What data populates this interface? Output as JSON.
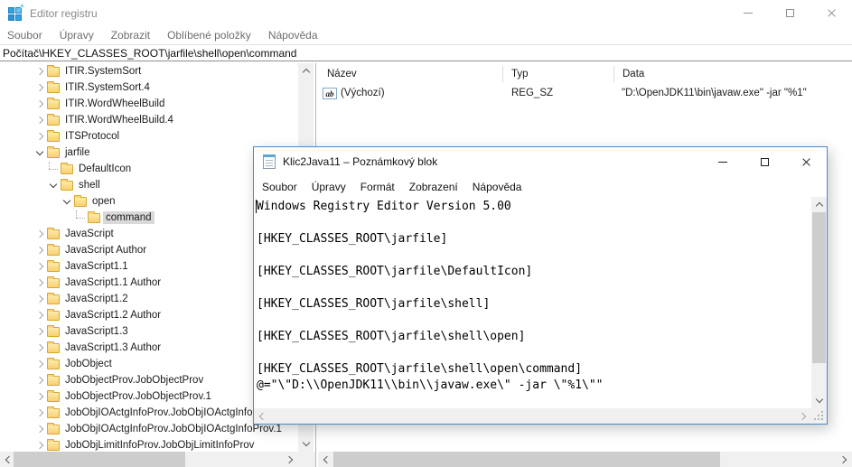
{
  "colors": {
    "accent-blue": "#4a8ac9",
    "selection-gray": "#d9d9d9",
    "scroll-track": "#f0f0f0",
    "scroll-thumb": "#cdcdcd",
    "reg-sz-red": "#c00000"
  },
  "regedit": {
    "title": "Editor registru",
    "menu": [
      "Soubor",
      "Úpravy",
      "Zobrazit",
      "Oblíbené položky",
      "Nápověda"
    ],
    "address": "Počítač\\HKEY_CLASSES_ROOT\\jarfile\\shell\\open\\command",
    "tree": [
      {
        "label": "ITIR.SystemSort",
        "level": 0,
        "state": "collapsed"
      },
      {
        "label": "ITIR.SystemSort.4",
        "level": 0,
        "state": "collapsed"
      },
      {
        "label": "ITIR.WordWheelBuild",
        "level": 0,
        "state": "collapsed"
      },
      {
        "label": "ITIR.WordWheelBuild.4",
        "level": 0,
        "state": "collapsed"
      },
      {
        "label": "ITSProtocol",
        "level": 0,
        "state": "collapsed"
      },
      {
        "label": "jarfile",
        "level": 0,
        "state": "expanded"
      },
      {
        "label": "DefaultIcon",
        "level": 1,
        "state": "leaf"
      },
      {
        "label": "shell",
        "level": 1,
        "state": "expanded"
      },
      {
        "label": "open",
        "level": 2,
        "state": "expanded"
      },
      {
        "label": "command",
        "level": 3,
        "state": "leaf",
        "selected": true
      },
      {
        "label": "JavaScript",
        "level": 0,
        "state": "collapsed"
      },
      {
        "label": "JavaScript Author",
        "level": 0,
        "state": "collapsed"
      },
      {
        "label": "JavaScript1.1",
        "level": 0,
        "state": "collapsed"
      },
      {
        "label": "JavaScript1.1 Author",
        "level": 0,
        "state": "collapsed"
      },
      {
        "label": "JavaScript1.2",
        "level": 0,
        "state": "collapsed"
      },
      {
        "label": "JavaScript1.2 Author",
        "level": 0,
        "state": "collapsed"
      },
      {
        "label": "JavaScript1.3",
        "level": 0,
        "state": "collapsed"
      },
      {
        "label": "JavaScript1.3 Author",
        "level": 0,
        "state": "collapsed"
      },
      {
        "label": "JobObject",
        "level": 0,
        "state": "collapsed"
      },
      {
        "label": "JobObjectProv.JobObjectProv",
        "level": 0,
        "state": "collapsed"
      },
      {
        "label": "JobObjectProv.JobObjectProv.1",
        "level": 0,
        "state": "collapsed"
      },
      {
        "label": "JobObjIOActgInfoProv.JobObjIOActgInfoProv",
        "level": 0,
        "state": "collapsed"
      },
      {
        "label": "JobObjIOActgInfoProv.JobObjIOActgInfoProv.1",
        "level": 0,
        "state": "collapsed"
      },
      {
        "label": "JobObjLimitInfoProv.JobObjLimitInfoProv",
        "level": 0,
        "state": "collapsed"
      }
    ],
    "list": {
      "columns": [
        "Název",
        "Typ",
        "Data"
      ],
      "value_icon": "ab",
      "rows": [
        {
          "name": "(Výchozí)",
          "type": "REG_SZ",
          "data": "\"D:\\OpenJDK11\\bin\\javaw.exe\" -jar \"%1\""
        }
      ]
    }
  },
  "notepad": {
    "title": "Klic2Java11 – Poznámkový blok",
    "menu": [
      "Soubor",
      "Úpravy",
      "Formát",
      "Zobrazení",
      "Nápověda"
    ],
    "content": "Windows Registry Editor Version 5.00\n\n[HKEY_CLASSES_ROOT\\jarfile]\n\n[HKEY_CLASSES_ROOT\\jarfile\\DefaultIcon]\n\n[HKEY_CLASSES_ROOT\\jarfile\\shell]\n\n[HKEY_CLASSES_ROOT\\jarfile\\shell\\open]\n\n[HKEY_CLASSES_ROOT\\jarfile\\shell\\open\\command]\n@=\"\\\"D:\\\\OpenJDK11\\\\bin\\\\javaw.exe\\\" -jar \\\"%1\\\"\""
  }
}
